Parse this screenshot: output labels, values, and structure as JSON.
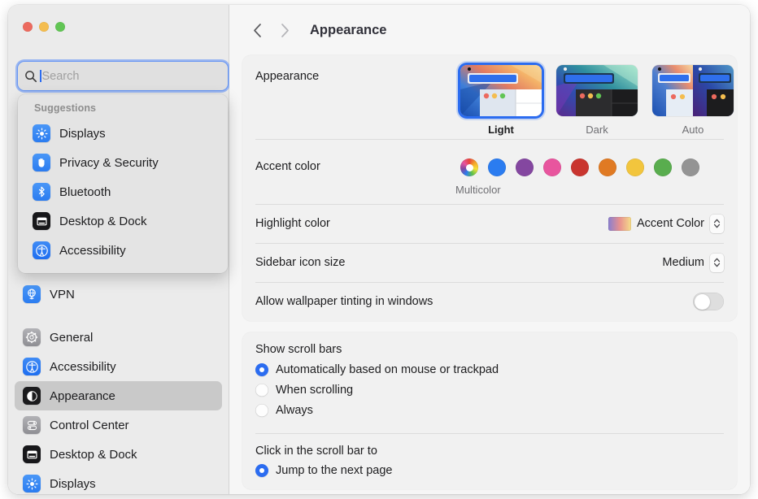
{
  "window": {
    "traffic_lights": [
      {
        "name": "close",
        "color": "#ec6a5e"
      },
      {
        "name": "minimize",
        "color": "#f4bd4f"
      },
      {
        "name": "zoom",
        "color": "#61c554"
      }
    ]
  },
  "search": {
    "placeholder": "Search",
    "value": "",
    "icon": "search-icon"
  },
  "suggestions": {
    "title": "Suggestions",
    "items": [
      {
        "label": "Displays",
        "icon": "displays-icon"
      },
      {
        "label": "Privacy & Security",
        "icon": "privacy-hand-icon"
      },
      {
        "label": "Bluetooth",
        "icon": "bluetooth-icon"
      },
      {
        "label": "Desktop & Dock",
        "icon": "desktop-dock-icon"
      },
      {
        "label": "Accessibility",
        "icon": "accessibility-icon"
      }
    ]
  },
  "sidebar": {
    "items": [
      {
        "label": "VPN",
        "icon": "vpn-icon",
        "selected": false
      },
      {
        "label": "General",
        "icon": "general-gear-icon",
        "selected": false
      },
      {
        "label": "Accessibility",
        "icon": "accessibility-icon",
        "selected": false
      },
      {
        "label": "Appearance",
        "icon": "appearance-icon",
        "selected": true
      },
      {
        "label": "Control Center",
        "icon": "control-center-icon",
        "selected": false
      },
      {
        "label": "Desktop & Dock",
        "icon": "desktop-dock-icon",
        "selected": false
      },
      {
        "label": "Displays",
        "icon": "displays-icon",
        "selected": false
      }
    ]
  },
  "toolbar": {
    "back_icon": "chevron-left-icon",
    "forward_icon": "chevron-right-icon",
    "title": "Appearance"
  },
  "appearance": {
    "label": "Appearance",
    "options": [
      {
        "name": "Light",
        "selected": true
      },
      {
        "name": "Dark",
        "selected": false
      },
      {
        "name": "Auto",
        "selected": false
      }
    ]
  },
  "accent_color": {
    "label": "Accent color",
    "selected_name": "Multicolor",
    "swatches": [
      {
        "name": "Multicolor",
        "color": "multicolor",
        "selected": true
      },
      {
        "name": "Blue",
        "color": "#2b7cf0",
        "selected": false
      },
      {
        "name": "Purple",
        "color": "#8447a0",
        "selected": false
      },
      {
        "name": "Pink",
        "color": "#e8559e",
        "selected": false
      },
      {
        "name": "Red",
        "color": "#c9352f",
        "selected": false
      },
      {
        "name": "Orange",
        "color": "#e07a23",
        "selected": false
      },
      {
        "name": "Yellow",
        "color": "#f2c53d",
        "selected": false
      },
      {
        "name": "Green",
        "color": "#59ad4e",
        "selected": false
      },
      {
        "name": "Graphite",
        "color": "#949494",
        "selected": false
      }
    ]
  },
  "highlight_color": {
    "label": "Highlight color",
    "value": "Accent Color"
  },
  "sidebar_icon_size": {
    "label": "Sidebar icon size",
    "value": "Medium"
  },
  "wallpaper_tinting": {
    "label": "Allow wallpaper tinting in windows",
    "enabled": false
  },
  "show_scroll_bars": {
    "title": "Show scroll bars",
    "options": [
      {
        "label": "Automatically based on mouse or trackpad",
        "selected": true
      },
      {
        "label": "When scrolling",
        "selected": false
      },
      {
        "label": "Always",
        "selected": false
      }
    ]
  },
  "click_scroll_bar": {
    "title": "Click in the scroll bar to",
    "options": [
      {
        "label": "Jump to the next page",
        "selected": true
      }
    ]
  }
}
